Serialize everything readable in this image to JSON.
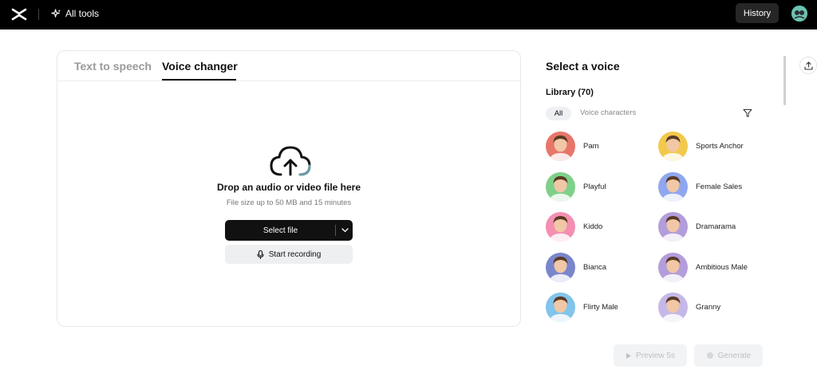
{
  "topbar": {
    "all_tools_label": "All tools",
    "history_label": "History",
    "icons": {
      "logo": "capcut-logo",
      "sparkle": "sparkle-icon",
      "avatar": "user-avatar"
    }
  },
  "panel": {
    "tabs": [
      {
        "label": "Text to speech",
        "active": false
      },
      {
        "label": "Voice changer",
        "active": true
      }
    ],
    "drop_title": "Drop an audio or video file here",
    "drop_subtitle": "File size up to 50 MB and 15 minutes",
    "select_file_label": "Select file",
    "start_recording_label": "Start recording"
  },
  "voices_panel": {
    "title": "Select a voice",
    "library_label": "Library (70)",
    "filters": {
      "all": "All",
      "voice_characters": "Voice characters"
    },
    "voices": [
      {
        "name": "Pam",
        "color": "#e8766a"
      },
      {
        "name": "Sports Anchor",
        "color": "#f2c94c"
      },
      {
        "name": "Playful",
        "color": "#7fd08a"
      },
      {
        "name": "Female Sales",
        "color": "#8fa7ef"
      },
      {
        "name": "Kiddo",
        "color": "#f48fb1"
      },
      {
        "name": "Dramarama",
        "color": "#b39ddb"
      },
      {
        "name": "Bianca",
        "color": "#7986cb"
      },
      {
        "name": "Ambitious Male",
        "color": "#b39ddb"
      },
      {
        "name": "Flirty Male",
        "color": "#81c4ec"
      },
      {
        "name": "Granny",
        "color": "#c5b8e8"
      }
    ]
  },
  "actions": {
    "preview_label": "Preview 5s",
    "generate_label": "Generate"
  }
}
